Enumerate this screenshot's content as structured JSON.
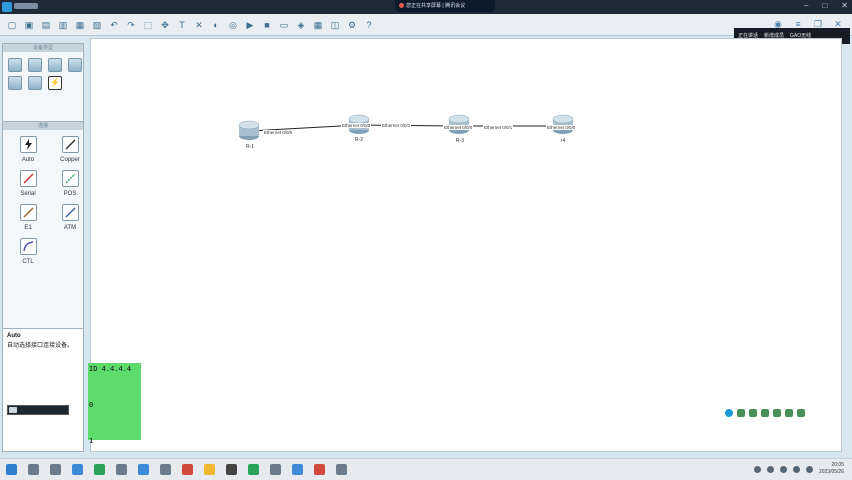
{
  "titlebar": {
    "meeting_text": "您正在共享屏幕 | 腾讯会议"
  },
  "notify": {
    "items": [
      "正在讲话",
      "新增成员",
      "GAO无线"
    ]
  },
  "start_button": "开始",
  "devices_panel": {
    "title": "设备类型"
  },
  "connections_panel": {
    "title": "连接",
    "items": [
      {
        "label": "Auto",
        "icon": "auto-cable-icon"
      },
      {
        "label": "Copper",
        "icon": "copper-cable-icon"
      },
      {
        "label": "Serial",
        "icon": "serial-cable-icon"
      },
      {
        "label": "POS",
        "icon": "pos-cable-icon"
      },
      {
        "label": "E1",
        "icon": "e1-cable-icon"
      },
      {
        "label": "ATM",
        "icon": "atm-cable-icon"
      },
      {
        "label": "CTL",
        "icon": "ctl-cable-icon"
      }
    ]
  },
  "description": {
    "title": "Auto",
    "text": "自动选择接口连接设备。"
  },
  "topology": {
    "nodes": [
      {
        "id": "r1",
        "label": "R-1"
      },
      {
        "id": "r2",
        "label": "R-2"
      },
      {
        "id": "r3",
        "label": "R-3"
      },
      {
        "id": "r4",
        "label": "r4"
      }
    ],
    "links": [
      {
        "label_a": "Ethernet 0/0/0",
        "label_b": "Ethernet 0/0/0"
      },
      {
        "label_a": "Ethernet 0/0/1",
        "label_b": "Ethernet 0/0/0"
      },
      {
        "label_a": "Ethernet 0/0/1",
        "label_b": "Ethernet 0/0/0"
      }
    ]
  },
  "terminal_overlay": {
    "lines": [
      "ID 4.4.4.4",
      "",
      "",
      "",
      "0",
      "",
      "",
      "",
      "1"
    ]
  },
  "taskbar": {
    "time": "20:05",
    "date": "2023/05/26"
  }
}
